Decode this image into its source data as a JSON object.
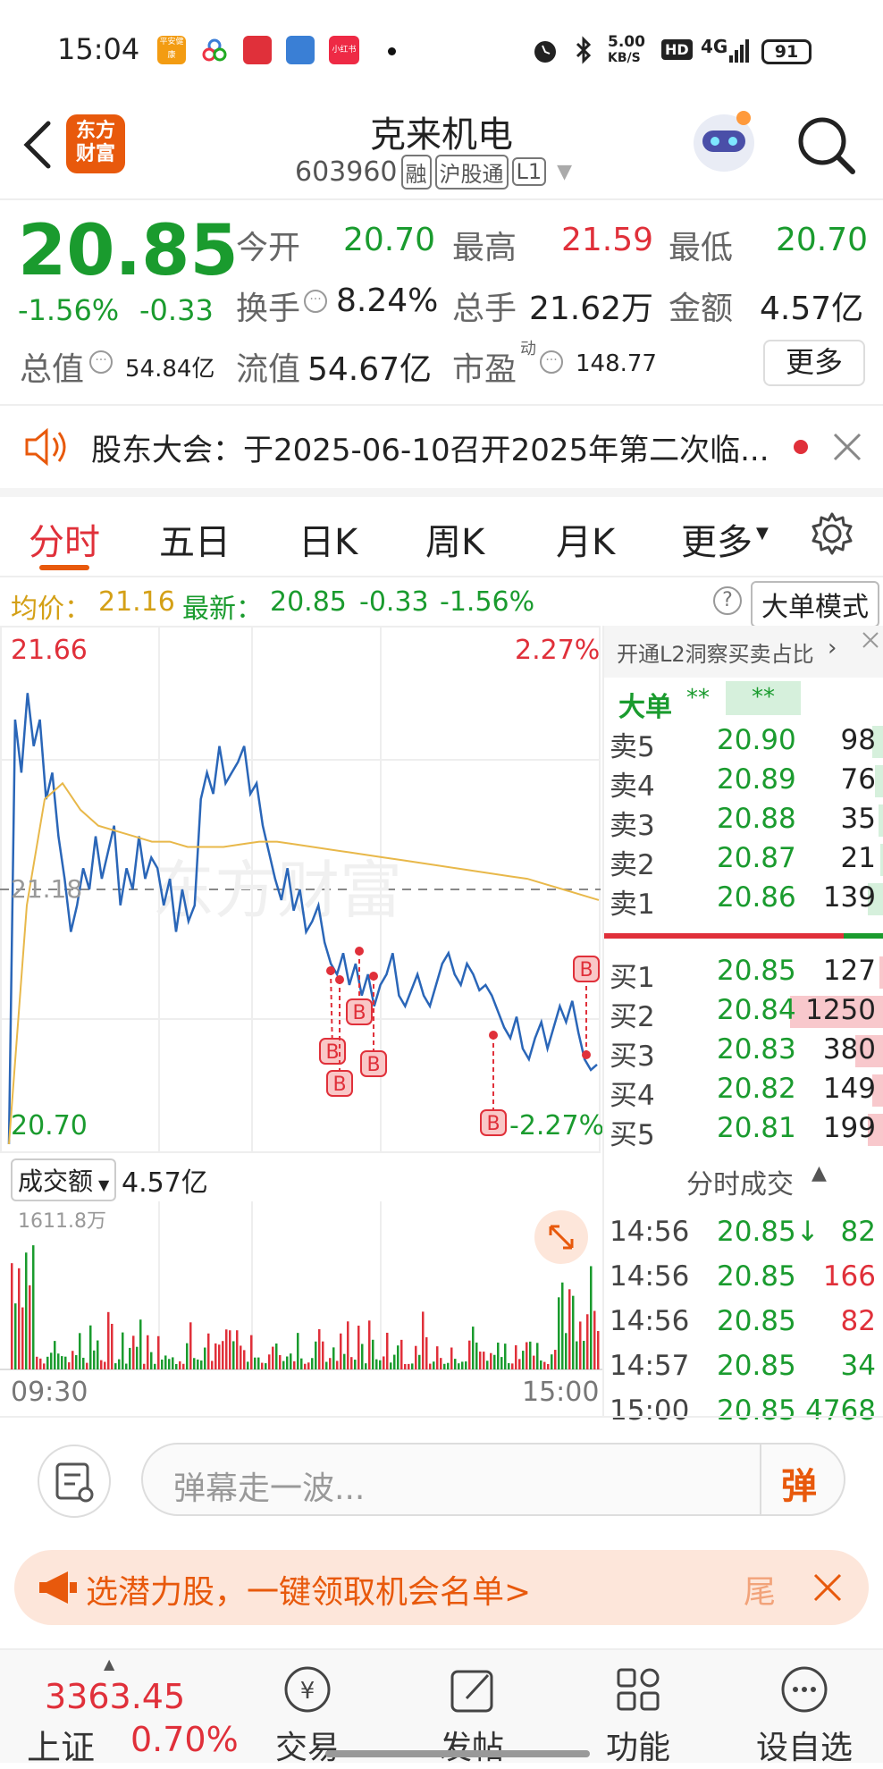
{
  "status_bar": {
    "time": "15:04",
    "app_icons": [
      "平安健康",
      "app-icon",
      "app-icon",
      "app-icon",
      "小红书"
    ],
    "net_speed_top": "5.00",
    "net_speed_unit": "KB/S",
    "hd": "HD",
    "signal": "4G",
    "battery": "91"
  },
  "header": {
    "logo_line1": "东方",
    "logo_line2": "财富",
    "stock_name": "克来机电",
    "stock_code": "603960",
    "badges": [
      "融",
      "沪股通",
      "L1"
    ]
  },
  "quote": {
    "price": "20.85",
    "change_pct": "-1.56%",
    "change_abs": "-0.33",
    "open_label": "今开",
    "open_value": "20.70",
    "high_label": "最高",
    "high_value": "21.59",
    "low_label": "最低",
    "low_value": "20.70",
    "turnover_label": "换手",
    "turnover_value": "8.24%",
    "volume_label": "总手",
    "volume_value": "21.62万",
    "amount_label": "金额",
    "amount_value": "4.57亿",
    "mcap_label": "总值",
    "mcap_value": "54.84亿",
    "float_label": "流值",
    "float_value": "54.67亿",
    "pe_label": "市盈",
    "pe_sup": "动",
    "pe_value": "148.77",
    "more_label": "更多"
  },
  "notice": {
    "text": "股东大会：于2025-06-10召开2025年第二次临..."
  },
  "tabs": [
    {
      "label": "分时",
      "active": true
    },
    {
      "label": "五日"
    },
    {
      "label": "日K"
    },
    {
      "label": "周K"
    },
    {
      "label": "月K"
    },
    {
      "label": "更多"
    }
  ],
  "info_bar": {
    "avg_label": "均价：",
    "avg_value": "21.16",
    "latest_label": "最新：",
    "latest_value": "20.85",
    "latest_change": "-0.33",
    "latest_pct": "-1.56%",
    "help_icon": "?",
    "mode_button": "大单模式"
  },
  "chart_data": {
    "type": "line",
    "time_range": [
      "09:30",
      "15:00"
    ],
    "y_labels_left": {
      "top": "21.66",
      "mid": "21.18",
      "bottom": "20.70"
    },
    "y_labels_right": {
      "top": "2.27%",
      "bottom": "-2.27%"
    },
    "ylim": [
      20.7,
      21.66
    ],
    "prev_close": 21.18,
    "series": [
      {
        "name": "price",
        "color": "#2a66b8",
        "values": [
          20.7,
          21.5,
          21.4,
          21.55,
          21.45,
          21.5,
          21.35,
          21.4,
          21.28,
          21.2,
          21.1,
          21.15,
          21.22,
          21.18,
          21.28,
          21.2,
          21.25,
          21.3,
          21.15,
          21.22,
          21.18,
          21.28,
          21.2,
          21.24,
          21.22,
          21.15,
          21.2,
          21.1,
          21.18,
          21.12,
          21.15,
          21.35,
          21.4,
          21.36,
          21.45,
          21.38,
          21.4,
          21.42,
          21.45,
          21.36,
          21.38,
          21.3,
          21.25,
          21.2,
          21.16,
          21.22,
          21.14,
          21.18,
          21.1,
          21.12,
          21.15,
          21.08,
          21.04,
          21.02,
          21.06,
          21.0,
          21.04,
          20.98,
          21.02,
          20.96,
          21.0,
          21.02,
          21.06,
          20.98,
          20.96,
          20.99,
          21.02,
          20.98,
          20.96,
          21.0,
          21.04,
          21.06,
          21.02,
          21.0,
          21.04,
          21.02,
          20.99,
          21.0,
          20.98,
          20.95,
          20.92,
          20.9,
          20.94,
          20.88,
          20.86,
          20.9,
          20.93,
          20.88,
          20.92,
          20.96,
          20.93,
          20.97,
          20.91,
          20.86,
          20.84,
          20.85
        ]
      },
      {
        "name": "avg",
        "color": "#e8b84a",
        "values": [
          20.7,
          21.15,
          21.35,
          21.38,
          21.33,
          21.3,
          21.29,
          21.28,
          21.27,
          21.27,
          21.26,
          21.26,
          21.26,
          21.265,
          21.27,
          21.27,
          21.265,
          21.26,
          21.255,
          21.25,
          21.245,
          21.24,
          21.235,
          21.23,
          21.225,
          21.22,
          21.215,
          21.21,
          21.205,
          21.2,
          21.19,
          21.18,
          21.17,
          21.16
        ]
      }
    ],
    "buy_markers": [
      "B",
      "B",
      "B",
      "B",
      "B",
      "B"
    ],
    "volume": {
      "label": "成交额",
      "total": "4.57亿",
      "max_label": "1611.8万"
    }
  },
  "order_book": {
    "l2_text": "开通L2洞察买卖占比",
    "big_order_label": "大单",
    "big_order_val1": "**",
    "big_order_val2": "**",
    "asks": [
      {
        "label": "卖5",
        "price": "20.90",
        "vol": "98"
      },
      {
        "label": "卖4",
        "price": "20.89",
        "vol": "76"
      },
      {
        "label": "卖3",
        "price": "20.88",
        "vol": "35"
      },
      {
        "label": "卖2",
        "price": "20.87",
        "vol": "21"
      },
      {
        "label": "卖1",
        "price": "20.86",
        "vol": "139"
      }
    ],
    "bids": [
      {
        "label": "买1",
        "price": "20.85",
        "vol": "127"
      },
      {
        "label": "买2",
        "price": "20.84",
        "vol": "1250"
      },
      {
        "label": "买3",
        "price": "20.83",
        "vol": "380"
      },
      {
        "label": "买4",
        "price": "20.82",
        "vol": "149"
      },
      {
        "label": "买5",
        "price": "20.81",
        "vol": "199"
      }
    ],
    "bid_fill": [
      0.04,
      1.0,
      0.3,
      0.12,
      0.16
    ],
    "ask_fill": [
      0.08,
      0.06,
      0.03,
      0.02,
      0.11
    ]
  },
  "ticks": {
    "title": "分时成交",
    "rows": [
      {
        "time": "14:56",
        "price": "20.85↓",
        "vol": "82",
        "dir": "green"
      },
      {
        "time": "14:56",
        "price": "20.85",
        "vol": "166",
        "dir": "red"
      },
      {
        "time": "14:56",
        "price": "20.85",
        "vol": "82",
        "dir": "red"
      },
      {
        "time": "14:57",
        "price": "20.85",
        "vol": "34",
        "dir": "green"
      },
      {
        "time": "15:00",
        "price": "20.85",
        "vol": "4768",
        "dir": "green"
      }
    ]
  },
  "danmaku": {
    "placeholder": "弹幕走一波...",
    "send_label": "弹"
  },
  "promo": {
    "text": "选潜力股，一键领取机会名单>",
    "tail": "尾"
  },
  "bottom_nav": {
    "index_value": "3363.45",
    "index_name": "上证",
    "index_pct": "0.70%",
    "items": [
      "交易",
      "发帖",
      "功能",
      "设自选"
    ]
  }
}
